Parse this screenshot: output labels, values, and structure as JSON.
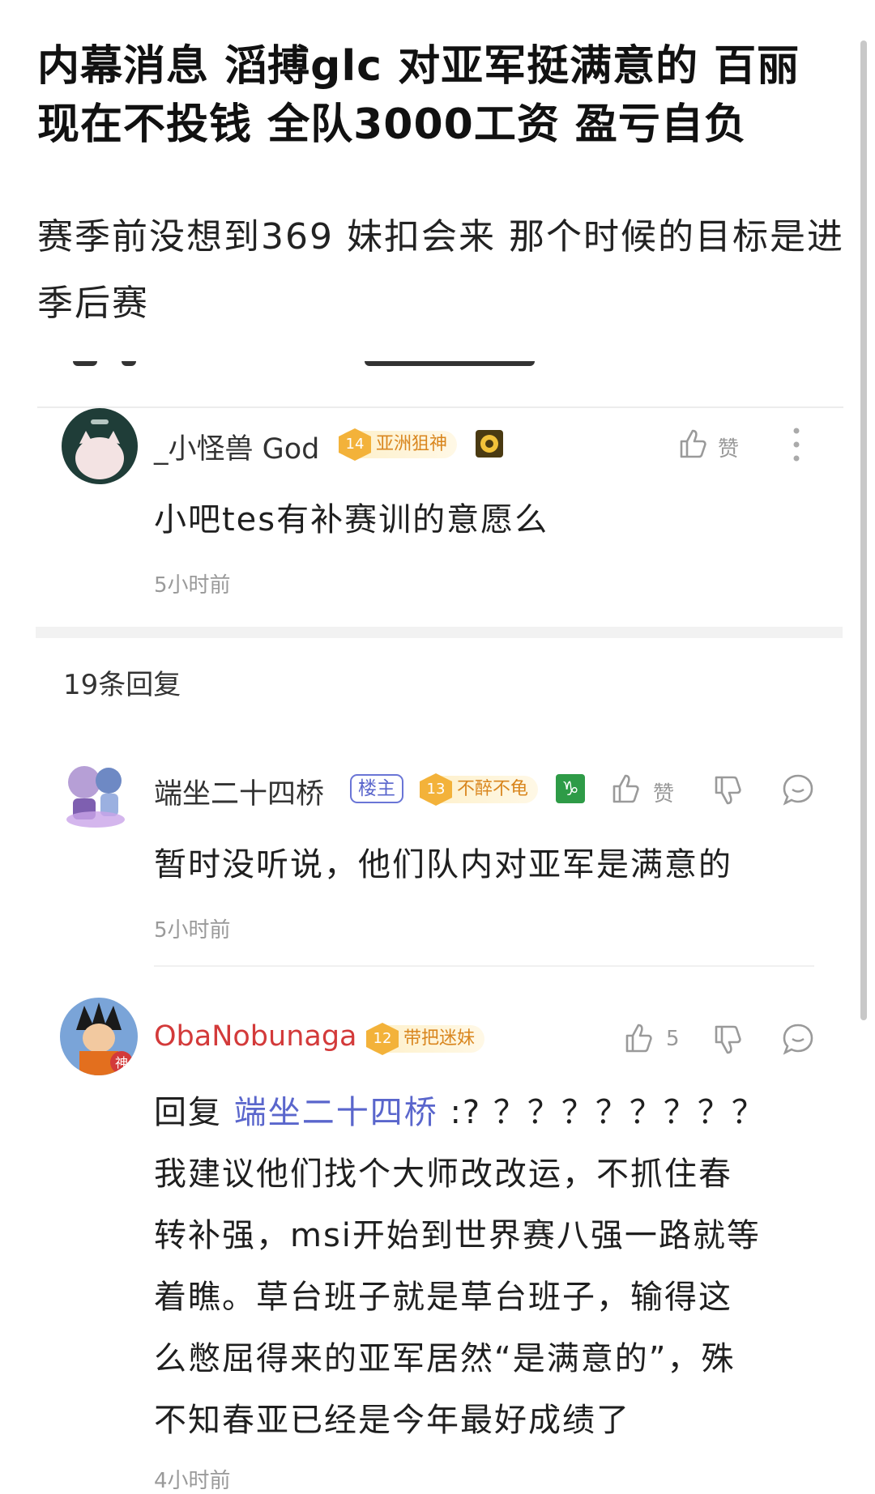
{
  "post": {
    "title": "内幕消息 滔搏glc 对亚军挺满意的 百丽现在不投钱 全队3000工资 盈亏自负",
    "body": "赛季前没想到369 妹扣会来 那个时候的目标是进季后赛"
  },
  "main_comment": {
    "username": "_小怪兽 God",
    "level": "14",
    "badge_title": "亚洲狙神",
    "like_label": "赞",
    "text": "小吧tes有补赛训的意愿么",
    "time": "5小时前"
  },
  "replies_header": "19条回复",
  "replies": [
    {
      "username": "端坐二十四桥",
      "owner_tag": "楼主",
      "level": "13",
      "badge_title": "不醉不龟",
      "like_label": "赞",
      "text": "暂时没听说，他们队内对亚军是满意的",
      "time": "5小时前"
    },
    {
      "username": "ObaNobunaga",
      "level": "12",
      "badge_title": "带把迷妹",
      "like_label": "5",
      "reply_prefix": "回复",
      "mention": "端坐二十四桥",
      "text_line1_rest": ":? ？？？？？？？？",
      "text_lines": [
        "我建议他们找个大师改改运，不抓住春",
        "转补强，msi开始到世界赛八强一路就等",
        "着瞧。草台班子就是草台班子，输得这",
        "么憋屈得来的亚军居然“是满意的”，殊",
        "不知春亚已经是今年最好成绩了"
      ],
      "time": "4小时前"
    }
  ],
  "colors": {
    "mention": "#5a66cc",
    "username_red": "#d33a3a",
    "badge_gold": "#f3b23a"
  }
}
